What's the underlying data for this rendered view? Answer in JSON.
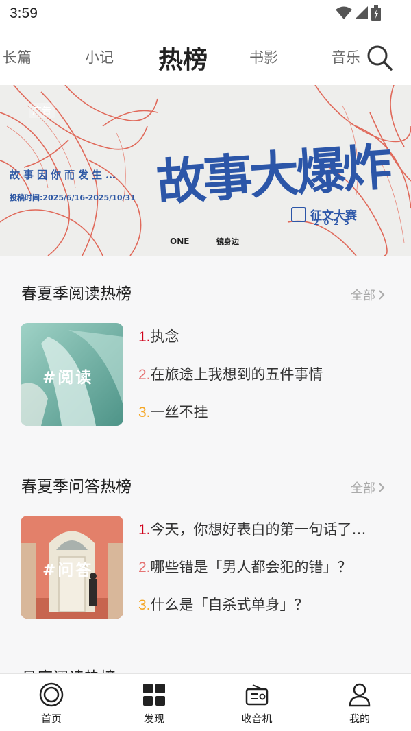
{
  "status_bar": {
    "time": "3:59",
    "icons": [
      "wifi-icon",
      "signal-icon",
      "battery-icon"
    ]
  },
  "top_tabs": [
    {
      "label": "长篇",
      "active": false
    },
    {
      "label": "小记",
      "active": false
    },
    {
      "label": "热榜",
      "active": true
    },
    {
      "label": "书影",
      "active": false
    },
    {
      "label": "音乐",
      "active": false
    }
  ],
  "search_icon": "search-icon",
  "banner": {
    "ad_tag": "广告",
    "tagline": "故事因你而发生…",
    "date": "投稿时间:2025/6/16-2025/10/31",
    "headline": "故事大爆炸",
    "contest_label": "征文大赛",
    "contest_year": "2025",
    "brand_one": "ONE",
    "brand_two": "镜身边"
  },
  "sections": [
    {
      "title": "春夏季阅读热榜",
      "more": "全部",
      "cover_label": "#阅读",
      "items": [
        {
          "rank": "1.",
          "text": "执念"
        },
        {
          "rank": "2.",
          "text": "在旅途上我想到的五件事情"
        },
        {
          "rank": "3.",
          "text": "一丝不挂"
        }
      ]
    },
    {
      "title": "春夏季问答热榜",
      "more": "全部",
      "cover_label": "#问答",
      "items": [
        {
          "rank": "1.",
          "text": "今天，你想好表白的第一句话了…"
        },
        {
          "rank": "2.",
          "text": "哪些错是「男人都会犯的错」？"
        },
        {
          "rank": "3.",
          "text": "什么是「自杀式单身」？"
        }
      ]
    },
    {
      "title": "月度阅读热榜"
    }
  ],
  "rank_colors": [
    "#d0021b",
    "#e57373",
    "#f5a623"
  ],
  "bottom_nav": [
    {
      "label": "首页",
      "icon": "home-ring-icon"
    },
    {
      "label": "发现",
      "icon": "grid-icon"
    },
    {
      "label": "收音机",
      "icon": "radio-icon"
    },
    {
      "label": "我的",
      "icon": "profile-icon"
    }
  ]
}
